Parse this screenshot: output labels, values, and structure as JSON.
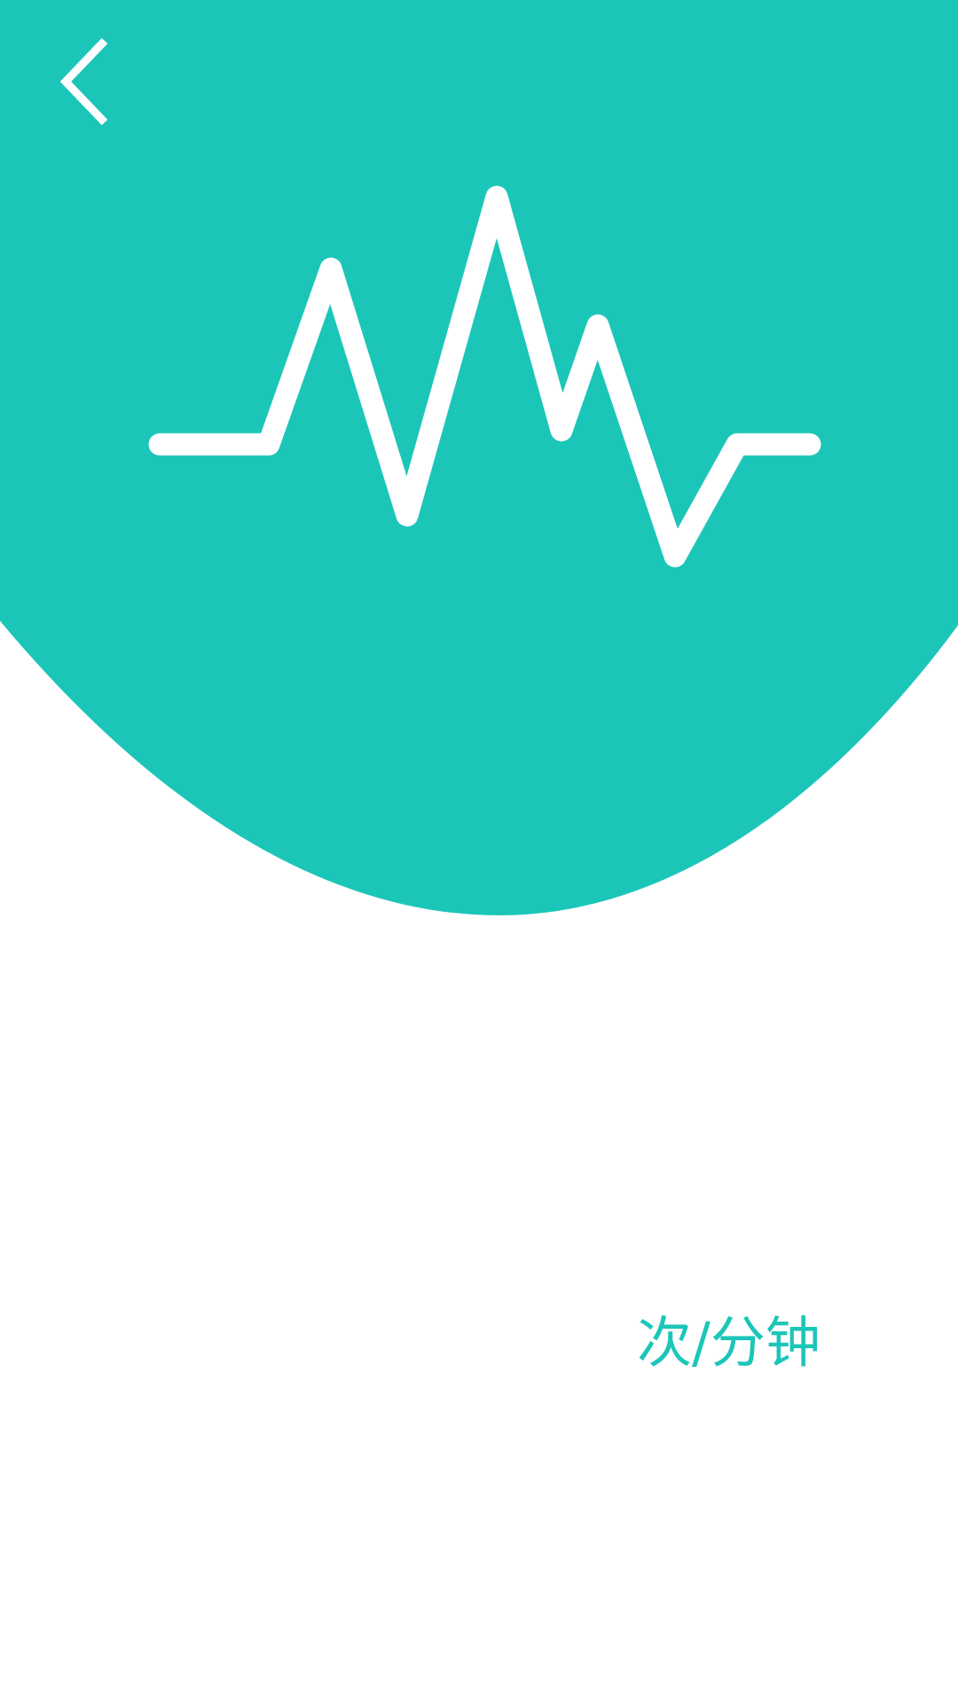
{
  "colors": {
    "accent": "#1bc6b9",
    "background": "#ffffff",
    "icon": "#ffffff"
  },
  "header": {
    "back_icon": "chevron-left-icon",
    "illustration_icon": "heartbeat-pulse-icon"
  },
  "measurement": {
    "value": "",
    "unit": "次/分钟"
  }
}
